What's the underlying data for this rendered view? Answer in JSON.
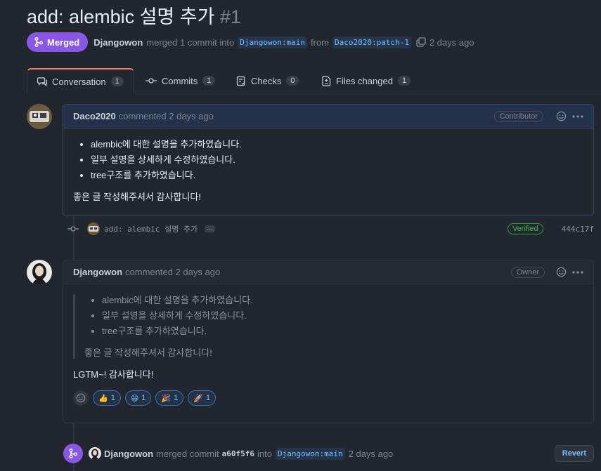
{
  "pr": {
    "title": "add: alembic 설명 추가",
    "number": "#1",
    "status": "Merged",
    "merged_by": "Djangowon",
    "merge_text": "merged 1 commit into",
    "base_branch": "Djangowon:main",
    "from_text": "from",
    "head_branch": "Daco2020:patch-1",
    "time": "2 days ago"
  },
  "tabs": [
    {
      "label": "Conversation",
      "count": "1"
    },
    {
      "label": "Commits",
      "count": "1"
    },
    {
      "label": "Checks",
      "count": "0"
    },
    {
      "label": "Files changed",
      "count": "1"
    }
  ],
  "comment1": {
    "author": "Daco2020",
    "action": "commented 2 days ago",
    "role": "Contributor",
    "items": [
      "alembic에 대한 설명을 추가하였습니다.",
      "일부 설명을 상세하게 수정하였습니다.",
      "tree구조를 추가하였습니다."
    ],
    "closing": "좋은 글 작성해주셔서 감사합니다!"
  },
  "commit": {
    "message": "add: alembic 설명 추가",
    "ellipsis": "···",
    "verified": "Verified",
    "sha": "444c17f"
  },
  "comment2": {
    "author": "Djangowon",
    "action": "commented 2 days ago",
    "role": "Owner",
    "quote_items": [
      "alembic에 대한 설명을 추가하였습니다.",
      "일부 설명을 상세하게 수정하였습니다.",
      "tree구조를 추가하였습니다."
    ],
    "quote_closing": "좋은 글 작성해주셔서 감사합니다!",
    "reply": "LGTM~! 감사합니다!",
    "reactions": [
      {
        "emoji": "👍",
        "count": "1"
      },
      {
        "emoji": "😄",
        "count": "1"
      },
      {
        "emoji": "🎉",
        "count": "1"
      },
      {
        "emoji": "🚀",
        "count": "1"
      }
    ]
  },
  "merge_event": {
    "user": "Djangowon",
    "text": "merged commit",
    "sha": "a60f5f6",
    "into": "into",
    "branch": "Djangowon:main",
    "time": "2 days ago",
    "revert_label": "Revert"
  },
  "colors": {
    "accent_merged": "#8957e5",
    "verified": "#3fb950",
    "link": "#79c0ff"
  }
}
